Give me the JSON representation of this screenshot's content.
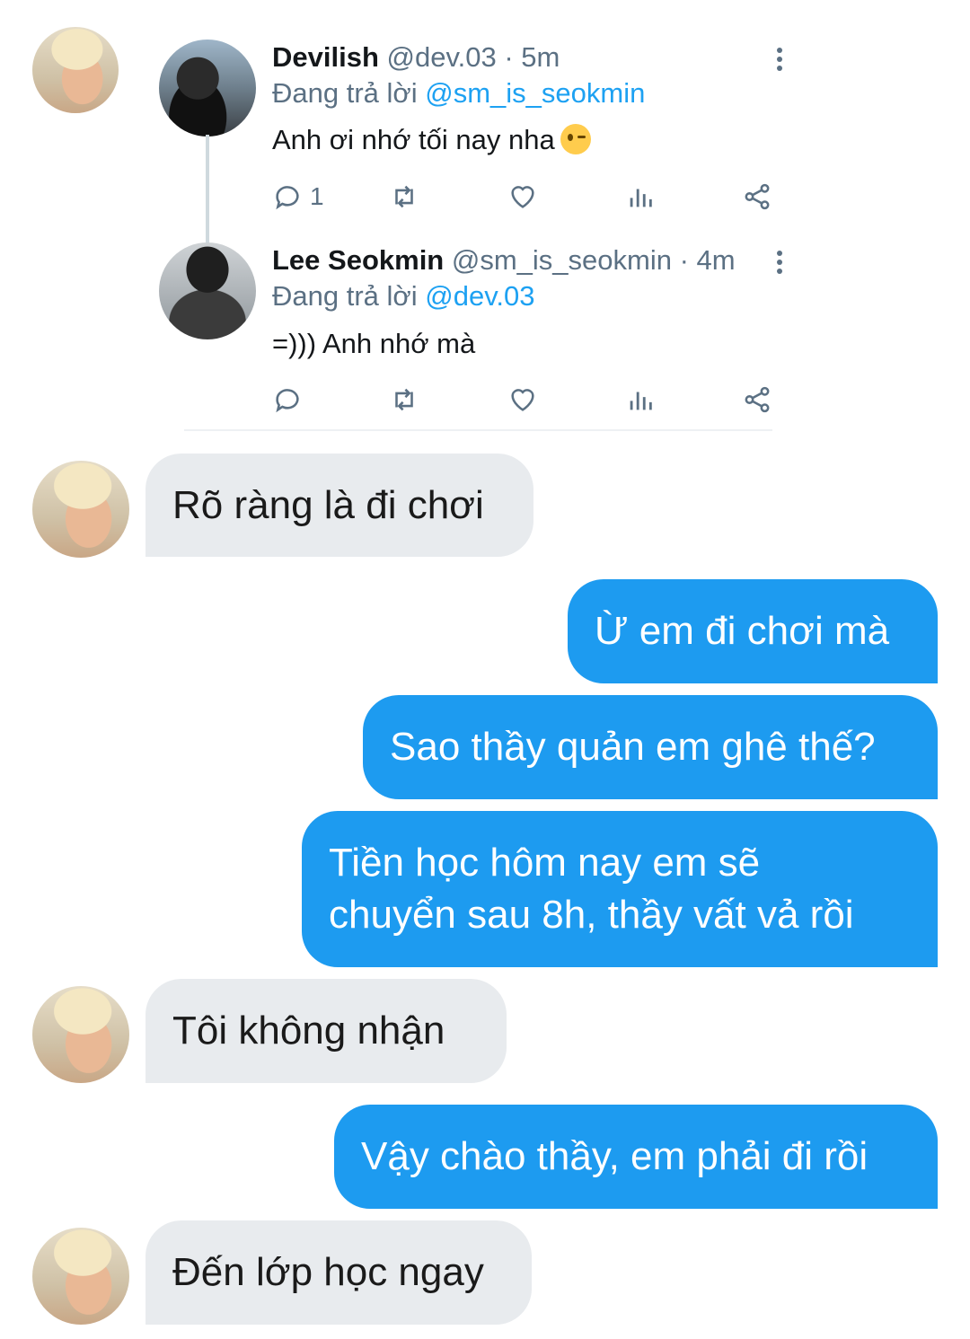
{
  "tweets": [
    {
      "name": "Devilish",
      "handle": "@dev.03 · 5m",
      "replying_prefix": "Đang trả lời",
      "replying_to": "@sm_is_seokmin",
      "text": "Anh ơi nhớ tối nay nha",
      "emoji": "winking-face",
      "reply_count": "1",
      "avatar": "dark-hoodie-avatar"
    },
    {
      "name": "Lee Seokmin",
      "handle": "@sm_is_seokmin · 4m",
      "replying_prefix": "Đang trả lời",
      "replying_to": "@dev.03",
      "text": "=))) Anh nhớ mà",
      "reply_count": "",
      "avatar": "mirror-selfie-avatar"
    }
  ],
  "messages": [
    {
      "side": "in",
      "text": "Rõ ràng là đi chơi"
    },
    {
      "side": "out",
      "text": "Ừ em đi chơi mà"
    },
    {
      "side": "out",
      "text": "Sao thầy quản em ghê thế?"
    },
    {
      "side": "out",
      "lines": [
        "Tiền học hôm nay em sẽ",
        "chuyển sau 8h, thầy vất vả rồi"
      ]
    },
    {
      "side": "in",
      "text": "Tôi không nhận"
    },
    {
      "side": "out",
      "text": "Vậy chào thầy, em phải đi rồi"
    },
    {
      "side": "in",
      "text": "Đến lớp học ngay"
    }
  ],
  "colors": {
    "accent": "#1da1f2",
    "outgoing_bubble": "#1d9bf0",
    "incoming_bubble": "#e8ebee",
    "secondary_text": "#5b7083"
  }
}
